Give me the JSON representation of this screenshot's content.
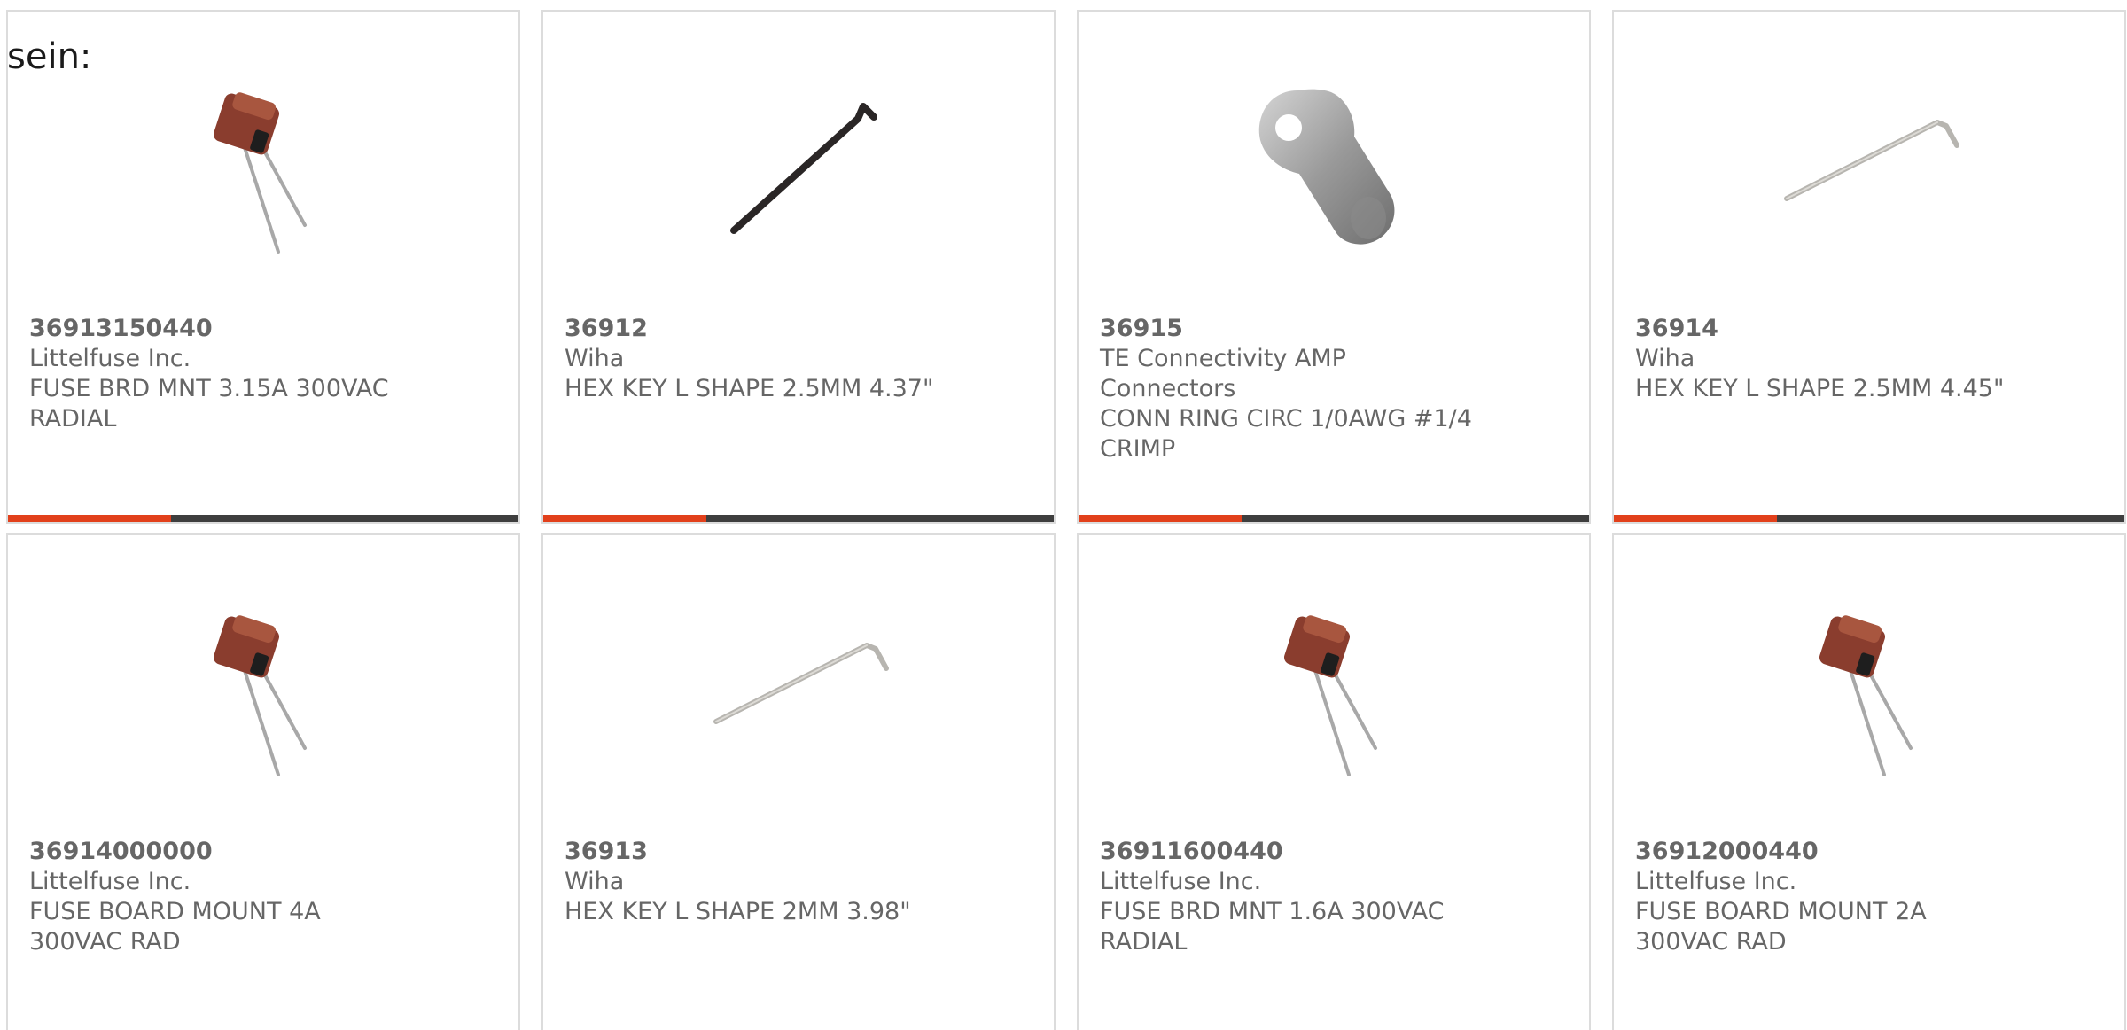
{
  "overlay_text": "sein:",
  "accent_color": "#e2401b",
  "bar_color": "#3e3e3e",
  "products": [
    {
      "part_number": "36913150440",
      "manufacturer": "Littelfuse Inc.",
      "description": "FUSE BRD MNT 3.15A 300VAC RADIAL",
      "image": "fuse-icon",
      "progress": 0.32
    },
    {
      "part_number": "36912",
      "manufacturer": "Wiha",
      "description": "HEX KEY L SHAPE 2.5MM 4.37\"",
      "image": "hex-key-dark-icon",
      "progress": 0.32
    },
    {
      "part_number": "36915",
      "manufacturer": "TE Connectivity AMP Connectors",
      "description": "CONN RING CIRC 1/0AWG #1/4 CRIMP",
      "image": "ring-terminal-icon",
      "progress": 0.32
    },
    {
      "part_number": "36914",
      "manufacturer": "Wiha",
      "description": "HEX KEY L SHAPE 2.5MM 4.45\"",
      "image": "hex-key-light-icon",
      "progress": 0.32
    },
    {
      "part_number": "36914000000",
      "manufacturer": "Littelfuse Inc.",
      "description": "FUSE BOARD MOUNT 4A 300VAC RAD",
      "image": "fuse-icon"
    },
    {
      "part_number": "36913",
      "manufacturer": "Wiha",
      "description": "HEX KEY L SHAPE 2MM 3.98\"",
      "image": "hex-key-light-icon"
    },
    {
      "part_number": "36911600440",
      "manufacturer": "Littelfuse Inc.",
      "description": "FUSE BRD MNT 1.6A 300VAC RADIAL",
      "image": "fuse-icon"
    },
    {
      "part_number": "36912000440",
      "manufacturer": "Littelfuse Inc.",
      "description": "FUSE BOARD MOUNT 2A 300VAC RAD",
      "image": "fuse-icon"
    }
  ]
}
